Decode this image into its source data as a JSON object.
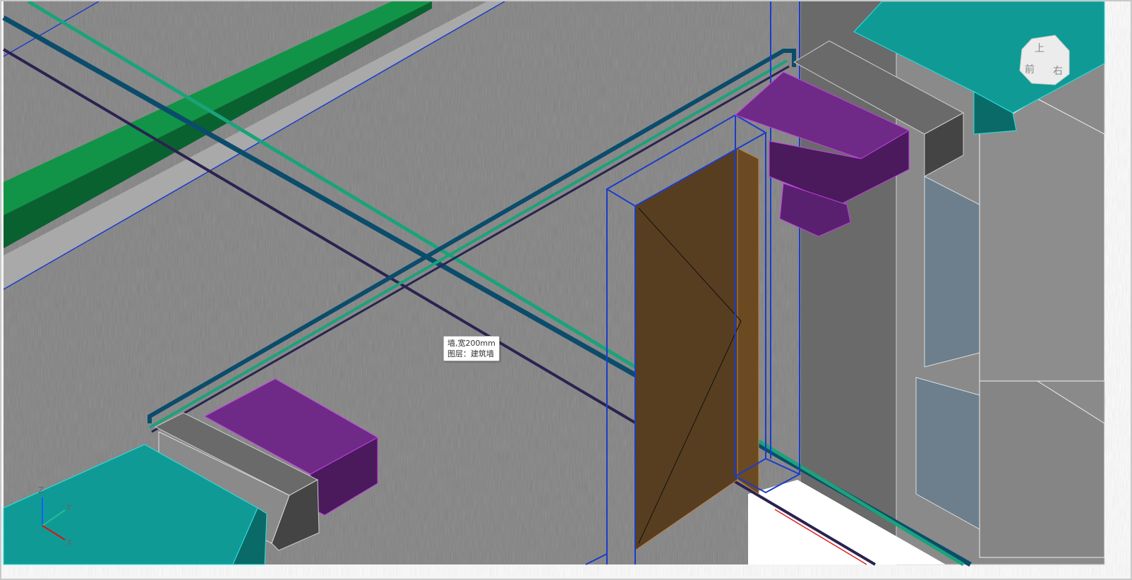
{
  "tooltip": {
    "line1": "墙,宽200mm",
    "line2": "图层：建筑墙"
  },
  "view_cube": {
    "top": "上",
    "front": "前",
    "right": "右"
  },
  "axes": {
    "z": "Z",
    "y": "Y",
    "x": "X"
  },
  "colors": {
    "background": "#808080",
    "duct_green": "#119447",
    "duct_teal": "#109a96",
    "unit_purple": "#6e2a86",
    "pipe_blue": "#0b4c6b",
    "pipe_green": "#1aa37a",
    "pipe_purple": "#2a2350",
    "door": "#573e20",
    "selection": "#1a3ccc"
  }
}
